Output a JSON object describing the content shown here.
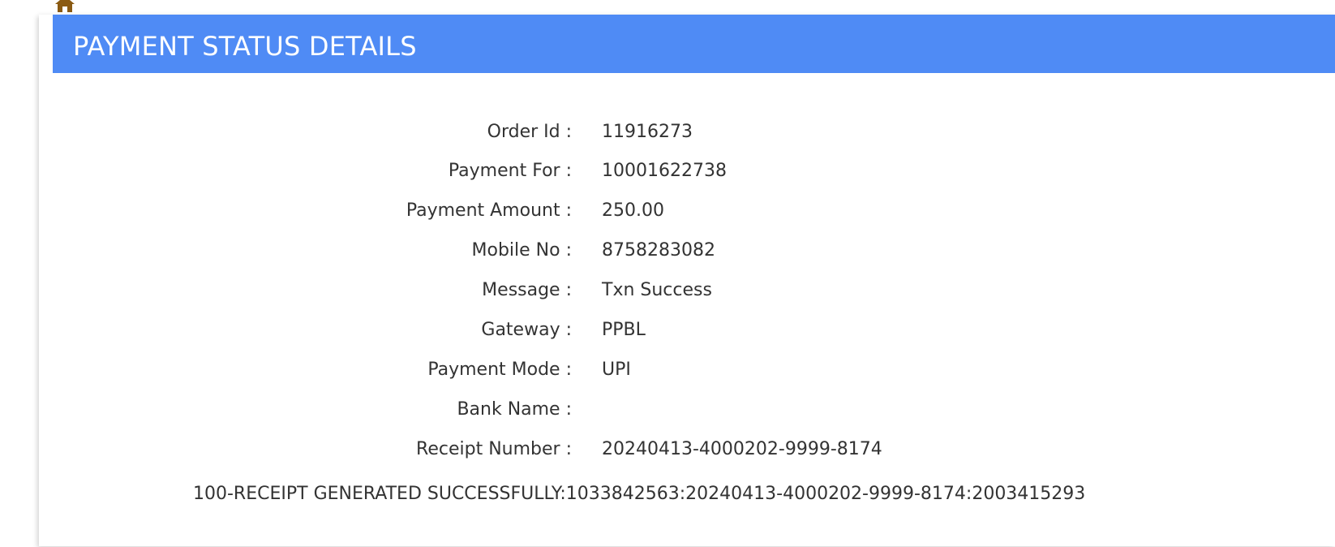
{
  "header": {
    "title": "PAYMENT STATUS DETAILS"
  },
  "nav": {
    "home_icon": "home-icon",
    "icon_color": "#8a5a12"
  },
  "details": [
    {
      "label": "Order Id :",
      "value": "11916273"
    },
    {
      "label": "Payment For :",
      "value": "10001622738"
    },
    {
      "label": "Payment Amount :",
      "value": "250.00"
    },
    {
      "label": "Mobile No :",
      "value": "8758283082"
    },
    {
      "label": "Message :",
      "value": "Txn Success"
    },
    {
      "label": "Gateway :",
      "value": "PPBL"
    },
    {
      "label": "Payment Mode :",
      "value": "UPI"
    },
    {
      "label": "Bank Name :",
      "value": ""
    },
    {
      "label": "Receipt Number :",
      "value": "20240413-4000202-9999-8174"
    }
  ],
  "result_message": "100-RECEIPT GENERATED SUCCESSFULLY:1033842563:20240413-4000202-9999-8174:2003415293",
  "colors": {
    "header_bg": "#4f8bf5",
    "header_text": "#ffffff",
    "body_text": "#333333"
  }
}
